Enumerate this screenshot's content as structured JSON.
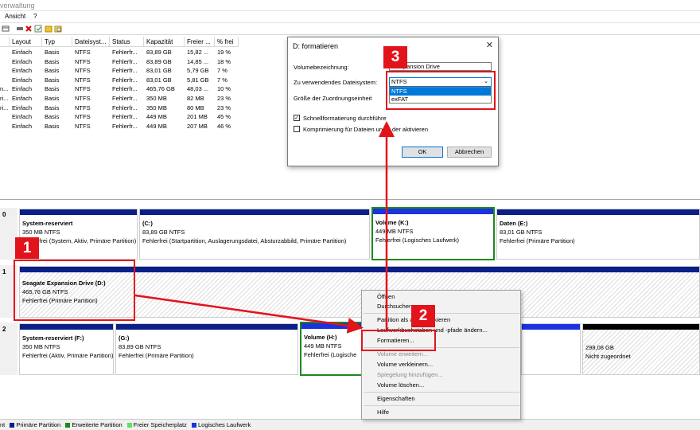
{
  "window": {
    "title": "verwaltung"
  },
  "menu": {
    "items": [
      "Ansicht",
      "?"
    ]
  },
  "toolbar": {
    "icons": [
      "properties-icon",
      "help-icon",
      "delete-icon",
      "check-icon",
      "folder-icon",
      "open-icon"
    ]
  },
  "volumes": {
    "headers": [
      "Layout",
      "Typ",
      "Dateisyst...",
      "Status",
      "Kapazität",
      "Freier ...",
      "% frei"
    ],
    "rows": [
      {
        "prefix": "",
        "cells": [
          "Einfach",
          "Basis",
          "NTFS",
          "Fehlerfr...",
          "83,89 GB",
          "15,82 ...",
          "19 %"
        ]
      },
      {
        "prefix": "",
        "cells": [
          "Einfach",
          "Basis",
          "NTFS",
          "Fehlerfr...",
          "83,89 GB",
          "14,85 ...",
          "18 %"
        ]
      },
      {
        "prefix": "",
        "cells": [
          "Einfach",
          "Basis",
          "NTFS",
          "Fehlerfr...",
          "83,01 GB",
          "5,79 GB",
          "7 %"
        ]
      },
      {
        "prefix": "",
        "cells": [
          "Einfach",
          "Basis",
          "NTFS",
          "Fehlerfr...",
          "83,01 GB",
          "5,81 GB",
          "7 %"
        ]
      },
      {
        "prefix": "n...",
        "cells": [
          "Einfach",
          "Basis",
          "NTFS",
          "Fehlerfr...",
          "465,76 GB",
          "48,03 ...",
          "10 %"
        ]
      },
      {
        "prefix": "ri...",
        "cells": [
          "Einfach",
          "Basis",
          "NTFS",
          "Fehlerfr...",
          "350 MB",
          "82 MB",
          "23 %"
        ]
      },
      {
        "prefix": "ri...",
        "cells": [
          "Einfach",
          "Basis",
          "NTFS",
          "Fehlerfr...",
          "350 MB",
          "80 MB",
          "23 %"
        ]
      },
      {
        "prefix": "",
        "cells": [
          "Einfach",
          "Basis",
          "NTFS",
          "Fehlerfr...",
          "449 MB",
          "201 MB",
          "45 %"
        ]
      },
      {
        "prefix": "",
        "cells": [
          "Einfach",
          "Basis",
          "NTFS",
          "Fehlerfr...",
          "449 MB",
          "207 MB",
          "46 %"
        ]
      }
    ]
  },
  "disks": {
    "disk0": {
      "label": "0",
      "partitions": [
        {
          "name": "System-reserviert",
          "size": "350 MB NTFS",
          "status": "Fehlerfrei (System, Aktiv, Primäre Partition)"
        },
        {
          "name": "(C:)",
          "size": "83,89 GB NTFS",
          "status": "Fehlerfrei (Startpartition, Auslagerungsdatei, Absturzabbild, Primäre Partition)"
        },
        {
          "name": "Volume  (K:)",
          "size": "449 MB NTFS",
          "status": "Fehlerfrei (Logisches Laufwerk)"
        },
        {
          "name": "Daten  (E:)",
          "size": "83,01 GB NTFS",
          "status": "Fehlerfrei (Primäre Partition)"
        }
      ]
    },
    "disk1": {
      "label": "1",
      "partitions": [
        {
          "name": "Seagate Expansion Drive  (D:)",
          "size": "465,76 GB NTFS",
          "status": "Fehlerfrei (Primäre Partition)"
        }
      ]
    },
    "disk2": {
      "label": "2",
      "partitions": [
        {
          "name": "System-reserviert  (F:)",
          "size": "350 MB NTFS",
          "status": "Fehlerfrei (Aktiv, Primäre Partition)"
        },
        {
          "name": "(G:)",
          "size": "83,89 GB NTFS",
          "status": "Fehlerfrei (Primäre Partition)"
        },
        {
          "name": "Volume  (H:)",
          "size": "449 MB NTFS",
          "status": "Fehlerfrei (Logische"
        },
        {
          "name": "",
          "size": "298,08 GB",
          "status": "Nicht zugeordnet"
        }
      ]
    }
  },
  "legend": {
    "items": [
      {
        "label": "nt",
        "color": "#000000"
      },
      {
        "label": "Primäre Partition",
        "color": "#0a1f88"
      },
      {
        "label": "Erweiterte Partition",
        "color": "#1a8a1a"
      },
      {
        "label": "Freier Speicherplatz",
        "color": "#60e060"
      },
      {
        "label": "Logisches Laufwerk",
        "color": "#1b32e0"
      }
    ]
  },
  "dialog": {
    "title": "D: formatieren",
    "close_glyph": "✕",
    "volume_label": "Volumebezeichnung:",
    "volume_value": "e Expansion Drive",
    "fs_label": "Zu verwendendes Dateisystem:",
    "fs_value": "NTFS",
    "fs_options": [
      "NTFS",
      "exFAT"
    ],
    "alloc_label": "Größe der Zuordnungseinheit",
    "quick_format": "Schnellformatierung durchführe",
    "compression_a": "Komprimierung für Dateien un",
    "compression_b": "der aktivieren",
    "ok": "OK",
    "cancel": "Abbrechen"
  },
  "context_menu": {
    "items": [
      {
        "label": "Öffnen",
        "enabled": true
      },
      {
        "label": "Durchsuchen",
        "enabled": true
      },
      {
        "label": "Partition als aktiv markieren",
        "enabled": true
      },
      {
        "label": "Laufwerkbuchstaben und -pfade ändern...",
        "enabled": true
      },
      {
        "label": "Formatieren...",
        "enabled": true
      },
      {
        "label": "Volume erweitern...",
        "enabled": false
      },
      {
        "label": "Volume verkleinern...",
        "enabled": true
      },
      {
        "label": "Spiegelung hinzufügen...",
        "enabled": false
      },
      {
        "label": "Volume löschen...",
        "enabled": true
      },
      {
        "label": "Eigenschaften",
        "enabled": true
      },
      {
        "label": "Hilfe",
        "enabled": true
      }
    ]
  },
  "annotations": {
    "color": "#e3131b",
    "badges": [
      "1",
      "2",
      "3"
    ]
  }
}
